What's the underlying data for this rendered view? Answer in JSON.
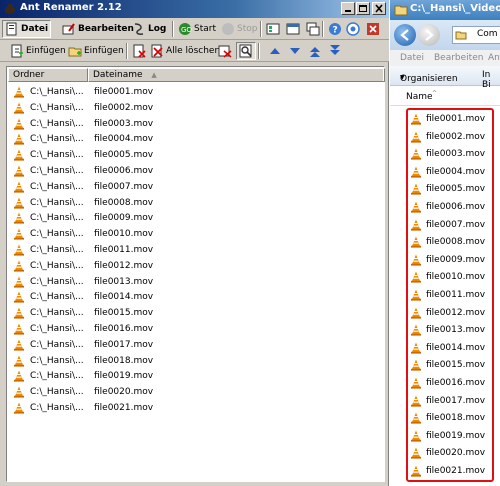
{
  "ant_window": {
    "title": "Ant Renamer 2.12",
    "toolbar1": {
      "datei": "Datei",
      "bearbeiten": "Bearbeiten",
      "log": "Log",
      "start": "Start",
      "stop": "Stop"
    },
    "toolbar2": {
      "insert_files": "Einfügen",
      "insert_folders": "Einfügen",
      "clear_all": "Alle löschen"
    },
    "list": {
      "columns": [
        "Ordner",
        "Dateiname"
      ],
      "rows": [
        {
          "folder": "C:\\_Hansi\\...",
          "file": "file0001.mov"
        },
        {
          "folder": "C:\\_Hansi\\...",
          "file": "file0002.mov"
        },
        {
          "folder": "C:\\_Hansi\\...",
          "file": "file0003.mov"
        },
        {
          "folder": "C:\\_Hansi\\...",
          "file": "file0004.mov"
        },
        {
          "folder": "C:\\_Hansi\\...",
          "file": "file0005.mov"
        },
        {
          "folder": "C:\\_Hansi\\...",
          "file": "file0006.mov"
        },
        {
          "folder": "C:\\_Hansi\\...",
          "file": "file0007.mov"
        },
        {
          "folder": "C:\\_Hansi\\...",
          "file": "file0008.mov"
        },
        {
          "folder": "C:\\_Hansi\\...",
          "file": "file0009.mov"
        },
        {
          "folder": "C:\\_Hansi\\...",
          "file": "file0010.mov"
        },
        {
          "folder": "C:\\_Hansi\\...",
          "file": "file0011.mov"
        },
        {
          "folder": "C:\\_Hansi\\...",
          "file": "file0012.mov"
        },
        {
          "folder": "C:\\_Hansi\\...",
          "file": "file0013.mov"
        },
        {
          "folder": "C:\\_Hansi\\...",
          "file": "file0014.mov"
        },
        {
          "folder": "C:\\_Hansi\\...",
          "file": "file0015.mov"
        },
        {
          "folder": "C:\\_Hansi\\...",
          "file": "file0016.mov"
        },
        {
          "folder": "C:\\_Hansi\\...",
          "file": "file0017.mov"
        },
        {
          "folder": "C:\\_Hansi\\...",
          "file": "file0018.mov"
        },
        {
          "folder": "C:\\_Hansi\\...",
          "file": "file0019.mov"
        },
        {
          "folder": "C:\\_Hansi\\...",
          "file": "file0020.mov"
        },
        {
          "folder": "C:\\_Hansi\\...",
          "file": "file0021.mov"
        }
      ]
    }
  },
  "explorer_window": {
    "title": "C:\\_Hansi\\_Videos",
    "address": "Com",
    "menu": {
      "datei": "Datei",
      "bearbeiten": "Bearbeiten",
      "ansicht": "An"
    },
    "commands": {
      "organize": "Organisieren",
      "include": "In Bi"
    },
    "column_header": "Name",
    "files": [
      "file0001.mov",
      "file0002.mov",
      "file0003.mov",
      "file0004.mov",
      "file0005.mov",
      "file0006.mov",
      "file0007.mov",
      "file0008.mov",
      "file0009.mov",
      "file0010.mov",
      "file0011.mov",
      "file0012.mov",
      "file0013.mov",
      "file0014.mov",
      "file0015.mov",
      "file0016.mov",
      "file0017.mov",
      "file0018.mov",
      "file0019.mov",
      "file0020.mov",
      "file0021.mov"
    ]
  },
  "colors": {
    "highlight_border": "#e01010",
    "vlc_orange": "#f28c00",
    "title_blue": "#0a246a"
  },
  "icons": {
    "file_icon": "vlc-cone-icon"
  }
}
